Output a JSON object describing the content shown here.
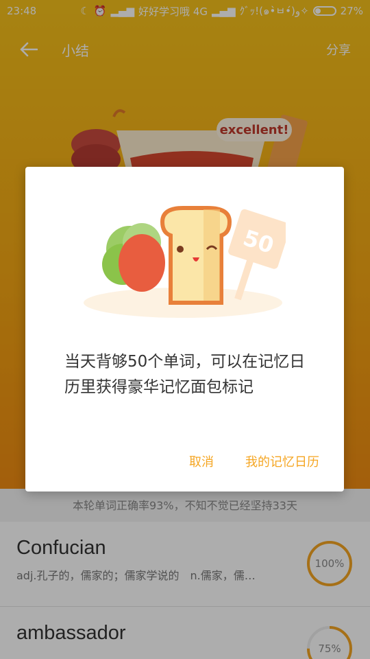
{
  "status_bar": {
    "time": "23:48",
    "carrier_text": "好好学习哦 4G",
    "extra_text": "ｸﾞｯ!(๑•̀ㅂ•́)و✧",
    "battery_percent_label": "27%",
    "battery_level": 0.27
  },
  "app_bar": {
    "title": "小结",
    "share_label": "分享"
  },
  "hero": {
    "badge_text": "excellent!"
  },
  "dialog": {
    "sign_number": "50",
    "message": "当天背够50个单词，可以在记忆日历里获得豪华记忆面包标记",
    "cancel_label": "取消",
    "confirm_label": "我的记忆日历"
  },
  "summary": {
    "text": "本轮单词正确率93%，不知不觉已经坚持33天"
  },
  "words": [
    {
      "word": "Confucian",
      "definition": "adj.孔子的，儒家的；儒家学说的　n.儒家，儒…",
      "accuracy_label": "100%",
      "accuracy": 1.0
    },
    {
      "word": "ambassador",
      "definition": "",
      "accuracy_label": "75%",
      "accuracy": 0.75
    }
  ],
  "colors": {
    "accent": "#f5a623",
    "hero_top": "#f7c21b",
    "hero_bottom": "#f08c12"
  }
}
